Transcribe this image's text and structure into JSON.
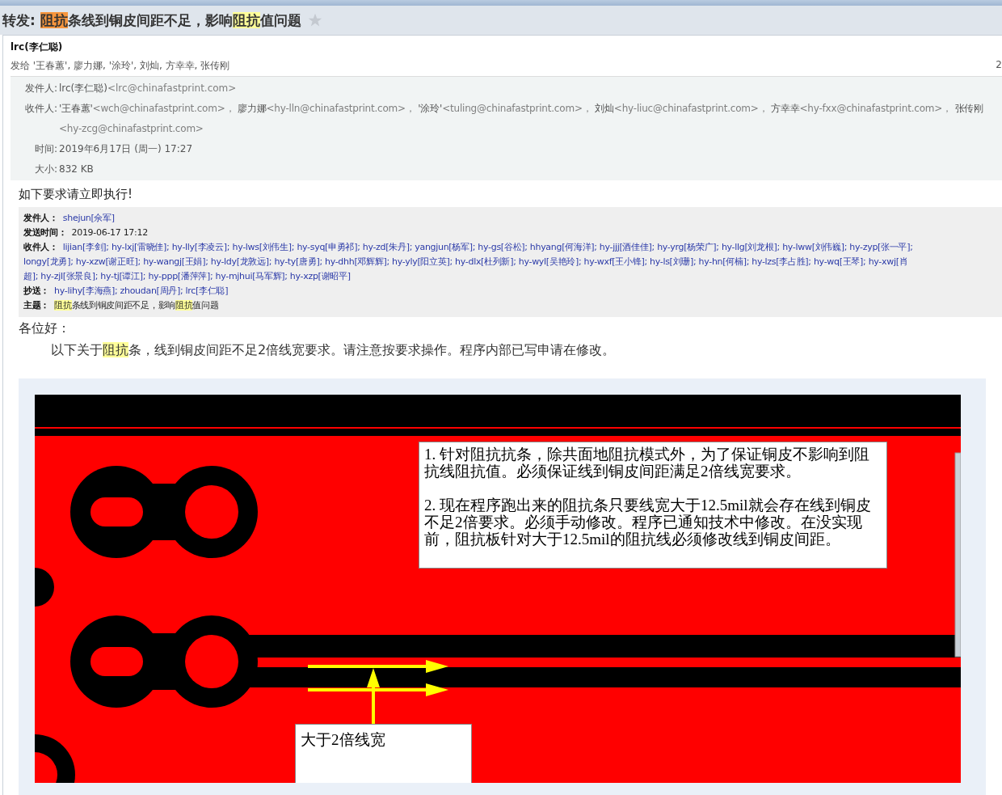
{
  "subject": {
    "segments": [
      {
        "text": "转发: "
      },
      {
        "text": "阻抗",
        "color": "#f7963e"
      },
      {
        "text": "条线到铜皮间距不足，影响"
      },
      {
        "text": "阻抗",
        "color": "#ffff99"
      },
      {
        "text": "值问题"
      }
    ],
    "starred": false
  },
  "message": {
    "sender": "lrc(李仁聪)",
    "sent_to": "发给 '王春蕙', 廖力娜, '涂玲', 刘灿, 方幸幸, 张传刚",
    "date_partial": "2",
    "details": {
      "from_label": "发件人:",
      "from_name": "lrc(李仁聪)",
      "from_email": "<lrc@chinafastprint.com>",
      "to_label": "收件人:",
      "to": [
        {
          "name": "'王春蕙'",
          "email": "<wch@chinafastprint.com>，"
        },
        {
          "name": "廖力娜",
          "email": "<hy-lln@chinafastprint.com>，"
        },
        {
          "name": "'涂玲'",
          "email": "<tuling@chinafastprint.com>，"
        },
        {
          "name": "刘灿",
          "email": "<hy-liuc@chinafastprint.com>，"
        },
        {
          "name": "方幸幸",
          "email": "<hy-fxx@chinafastprint.com>，"
        },
        {
          "name": "张传刚",
          "email": "<hy-zcg@chinafastprint.com>"
        }
      ],
      "time_label": "时间:",
      "time": "2019年6月17日 (周一) 17:27",
      "size_label": "大小:",
      "size": "832 KB"
    }
  },
  "body": {
    "intro": "如下要求请立即执行!",
    "quoted": {
      "from_label": "发件人：",
      "from": "shejun[佘军]",
      "sent_label": "发送时间：",
      "sent": "2019-06-17 17:12",
      "to_label": "收件人：",
      "to_lines": [
        "lijian[李剑]; hy-lxj[雷晓佳]; hy-lly[李凌云]; hy-lws[刘伟生]; hy-syq[申勇祁]; hy-zd[朱丹]; yangjun[杨军]; hy-gs[谷松]; hhyang[何海洋]; hy-jjj[酒佳佳]; hy-yrg[杨荣广]; hy-llg[刘龙根]; hy-lww[刘伟巍]; hy-zyp[张一平];",
        "longy[龙勇]; hy-xzw[谢正旺]; hy-wangj[王娟]; hy-ldy[龙敦远]; hy-ty[唐勇]; hy-dhh[邓辉辉]; hy-yly[阳立英]; hy-dlx[杜列新]; hy-wyl[吴艳玲]; hy-wxf[王小锋]; hy-ls[刘珊]; hy-hn[何楠]; hy-lzs[李占胜]; hy-wq[王琴]; hy-xwj[肖",
        "超]; hy-zjl[张景良]; hy-tj[谭江]; hy-ppp[潘萍萍]; hy-mjhui[马军辉]; hy-xzp[谢昭平]"
      ],
      "cc_label": "抄送：",
      "cc": "hy-lihy[李海燕]; zhoudan[周丹]; lrc[李仁聪]",
      "subject_label": "主题：",
      "subject_segments": [
        {
          "text": "阻抗",
          "color": "#ffff99"
        },
        {
          "text": "条线到铜皮间距不足，影响"
        },
        {
          "text": "阻抗",
          "color": "#ffff99"
        },
        {
          "text": "值问题"
        }
      ]
    },
    "greeting": "各位好：",
    "paragraph": [
      {
        "text": "以下关于"
      },
      {
        "text": "阻抗",
        "color": "#ffff99"
      },
      {
        "text": "条，线到铜皮间距不足2倍线宽要求。请注意按要求操作。程序内部已写申请在修改。"
      }
    ],
    "figure": {
      "note_1": [
        "1. 针对阻抗抗条，除共面地阻抗模式外，为了保证铜皮不影响到阻抗线阻抗值。必须保证线到铜皮间距满足2倍线宽要求。",
        "2. 现在程序跑出来的阻抗条只要线宽大于12.5mil就会存在线到铜皮不足2倍要求。必须手动修改。程序已通知技术中修改。在没实现前，阻抗板针对大于12.5mil的阻抗线必须修改线到铜皮间距。"
      ],
      "note_2": "大于2倍线宽"
    }
  }
}
